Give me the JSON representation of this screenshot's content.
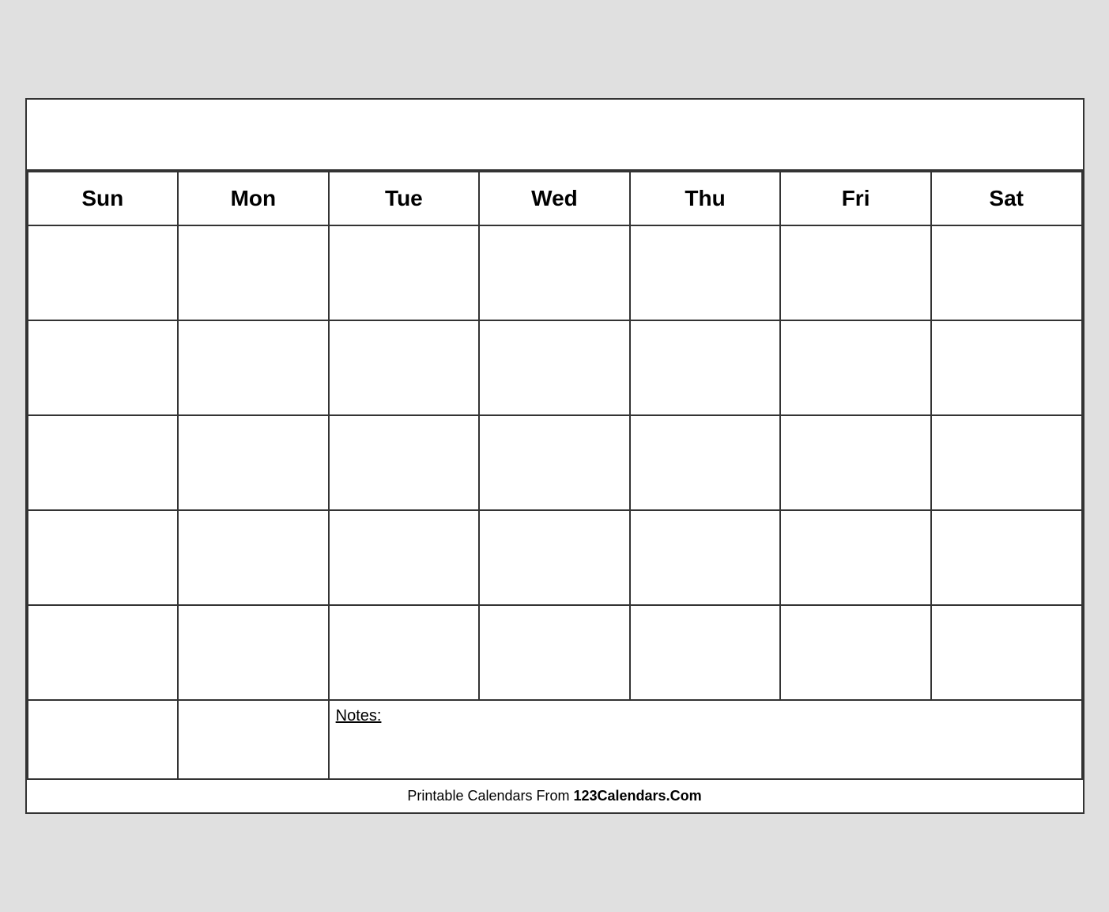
{
  "calendar": {
    "title": "",
    "days": [
      "Sun",
      "Mon",
      "Tue",
      "Wed",
      "Thu",
      "Fri",
      "Sat"
    ],
    "notes_label": "Notes:",
    "rows": 5
  },
  "footer": {
    "text_normal": "Printable Calendars From ",
    "text_bold": "123Calendars.Com"
  }
}
